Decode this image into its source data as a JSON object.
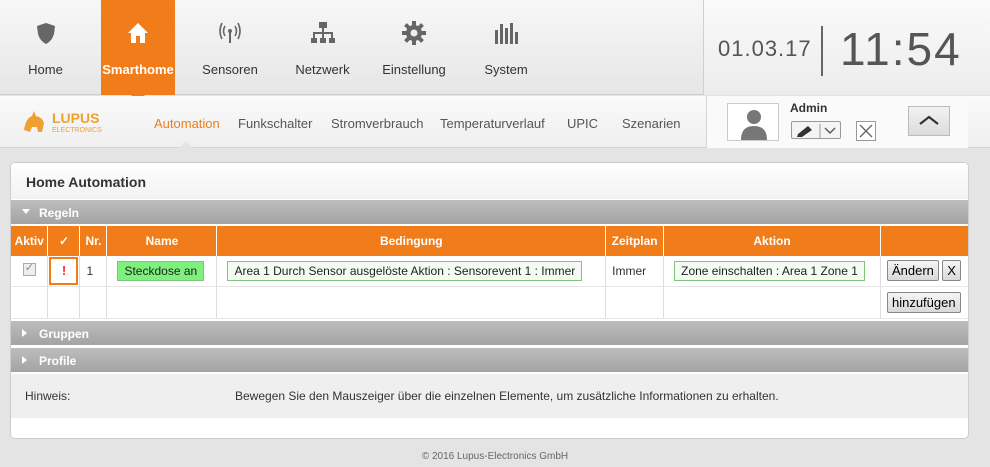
{
  "nav": {
    "items": [
      {
        "label": "Home",
        "icon": "shield-icon"
      },
      {
        "label": "Smarthome",
        "icon": "home-icon"
      },
      {
        "label": "Sensoren",
        "icon": "antenna-icon"
      },
      {
        "label": "Netzwerk",
        "icon": "network-icon"
      },
      {
        "label": "Einstellung",
        "icon": "gear-icon"
      },
      {
        "label": "System",
        "icon": "equalizer-icon"
      }
    ],
    "active": "Smarthome",
    "accent": "#f07d1a"
  },
  "clock": {
    "date": "01.03.17",
    "time": "11:54"
  },
  "logo": {
    "text": "LUPUS",
    "subtext": "ELECTRONICS"
  },
  "subnav": {
    "items": [
      "Automation",
      "Funkschalter",
      "Stromverbrauch",
      "Temperaturverlauf",
      "UPIC",
      "Szenarien"
    ],
    "active": "Automation"
  },
  "user": {
    "name": "Admin"
  },
  "panel": {
    "title": "Home Automation",
    "sections": {
      "rules": "Regeln",
      "groups": "Gruppen",
      "profiles": "Profile"
    },
    "table": {
      "headers": [
        "Aktiv",
        "✓",
        "Nr.",
        "Name",
        "Bedingung",
        "Zeitplan",
        "Aktion",
        ""
      ],
      "rows": [
        {
          "active": true,
          "warning": "!",
          "nr": "1",
          "name": "Steckdose an",
          "condition": "Area 1 Durch Sensor ausgelöste Aktion : Sensorevent 1 : Immer",
          "schedule": "Immer",
          "action": "Zone einschalten : Area 1 Zone 1",
          "edit_label": "Ändern",
          "delete_label": "X"
        }
      ],
      "add_label": "hinzufügen"
    },
    "hint": {
      "label": "Hinweis:",
      "text": "Bewegen Sie den Mauszeiger über die einzelnen Elemente, um zusätzliche Informationen zu erhalten."
    }
  },
  "footer": {
    "copyright": "© 2016 Lupus-Electronics GmbH"
  }
}
